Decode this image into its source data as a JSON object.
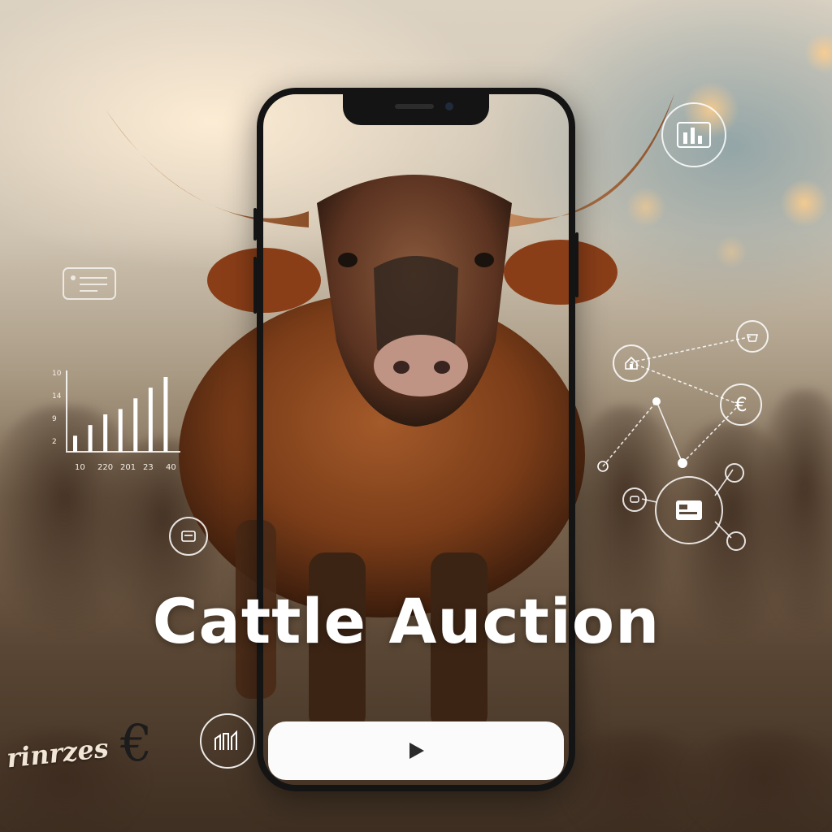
{
  "title": "Cattle Auction",
  "brand_text": "rinrzes",
  "currency_symbol": "€",
  "play_icon": "play-icon",
  "icons": [
    "card-icon",
    "bar-chart-icon",
    "analytics-icon",
    "house-icon",
    "basket-icon",
    "currency-icon",
    "payment-card-icon",
    "chat-icon",
    "badge-icon",
    "cattle-seal-icon"
  ],
  "chart_data": {
    "type": "bar",
    "categories": [
      "10",
      "220",
      "201",
      "23",
      "40"
    ],
    "y_tick_labels": [
      "10",
      "14",
      "9",
      "2"
    ],
    "values": [
      3,
      5,
      7,
      8,
      10,
      12,
      14
    ]
  },
  "colors": {
    "title": "#ffffff",
    "play_bar": "#fbfbfb",
    "phone_frame": "#141414"
  }
}
